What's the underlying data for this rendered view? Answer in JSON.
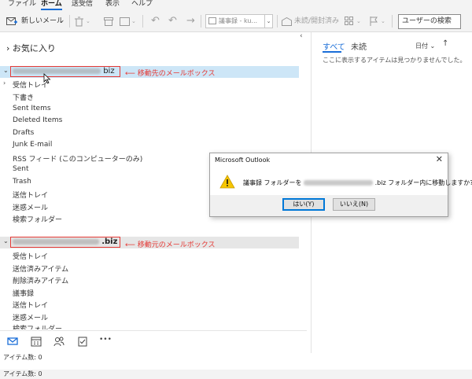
{
  "menu": {
    "tabs": [
      "ファイル",
      "ホーム",
      "送受信",
      "表示",
      "ヘルプ"
    ],
    "active_index": 1
  },
  "ribbon": {
    "new_mail": "新しいメール",
    "quick_step_placeholder": "議事録 - ku...",
    "read_unread": "未読/開封済み",
    "search_placeholder": "ユーザーの検索"
  },
  "folder_pane": {
    "favorites": "お気に入り",
    "collapse_glyph": "‹",
    "account1": {
      "suffix": "biz",
      "annotation": "移動先のメールボックス",
      "folders": [
        "受信トレイ",
        "下書き",
        "Sent Items",
        "Deleted Items",
        "Drafts",
        "Junk E-mail",
        "RSS フィード (このコンピューターのみ)",
        "Sent",
        "Trash",
        "送信トレイ",
        "迷惑メール",
        "検索フォルダー"
      ]
    },
    "account2": {
      "suffix": ".biz",
      "annotation": "移動元のメールボックス",
      "folders": [
        "受信トレイ",
        "送信済みアイテム",
        "削除済みアイテム",
        "議事録",
        "送信トレイ",
        "迷惑メール",
        "検索フォルダー"
      ]
    }
  },
  "bottom_nav": {
    "icons": [
      "mail-icon",
      "calendar-icon",
      "people-icon",
      "tasks-icon",
      "more-icon"
    ],
    "more_label": "•••"
  },
  "message_pane": {
    "tab_all": "すべて",
    "tab_unread": "未読",
    "sort_label": "日付",
    "empty_message": "ここに表示するアイテムは見つかりませんでした。"
  },
  "status": {
    "item_count_top": "アイテム数: 0",
    "item_count_bottom": "アイテム数: 0"
  },
  "dialog": {
    "title": "Microsoft Outlook",
    "close_glyph": "✕",
    "question_prefix": "議事録 フォルダーを",
    "question_suffix": ".biz フォルダー内に移動しますか?",
    "yes_label": "はい(Y)",
    "no_label": "いいえ(N)"
  },
  "colors": {
    "accent": "#1a6ed8",
    "annotation": "#e53935",
    "selection": "#cde6f7"
  }
}
